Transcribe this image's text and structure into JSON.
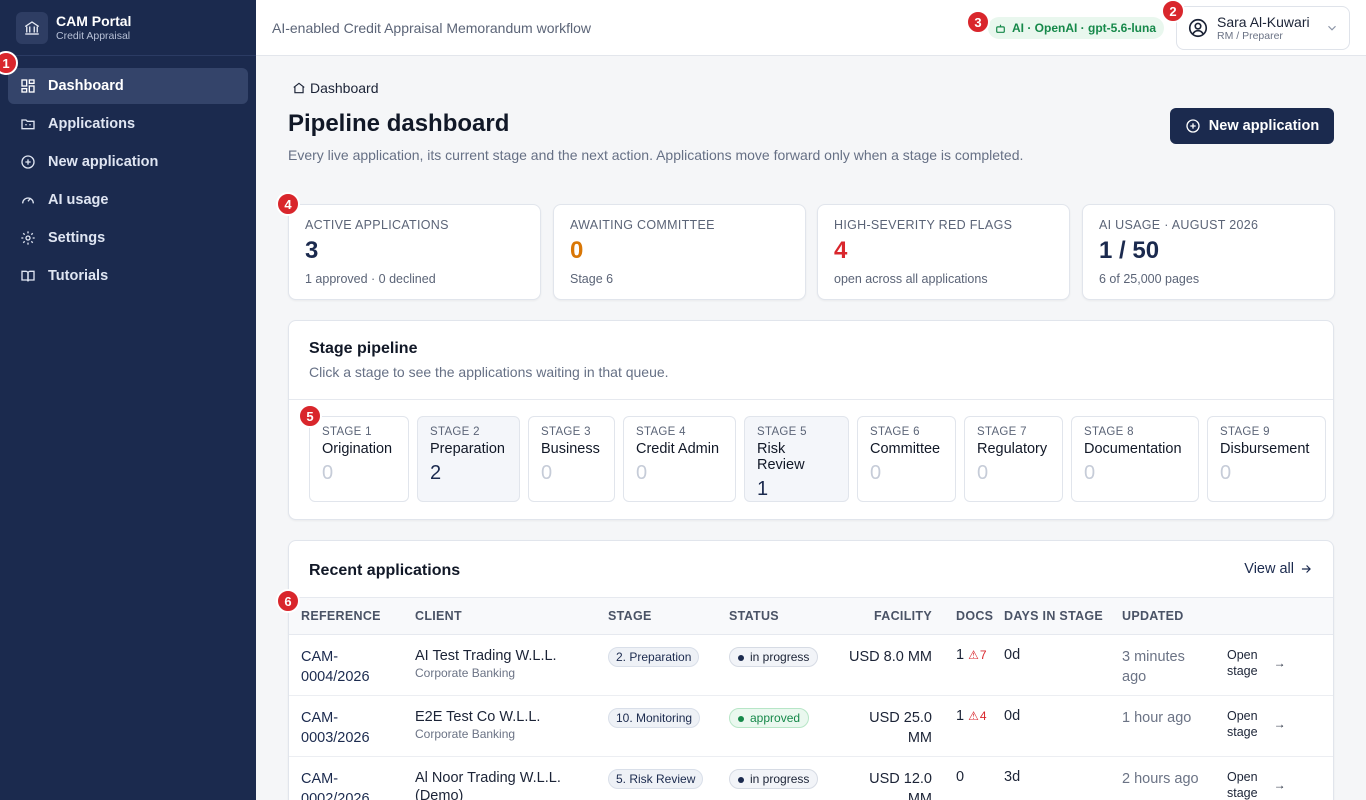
{
  "app": {
    "title": "CAM Portal",
    "subtitle": "Credit Appraisal"
  },
  "sidebar": {
    "items": [
      {
        "label": "Dashboard",
        "icon": "dashboard-icon"
      },
      {
        "label": "Applications",
        "icon": "folder-icon"
      },
      {
        "label": "New application",
        "icon": "plus-circle-icon"
      },
      {
        "label": "AI usage",
        "icon": "gauge-icon"
      },
      {
        "label": "Settings",
        "icon": "gear-icon"
      },
      {
        "label": "Tutorials",
        "icon": "book-icon"
      }
    ]
  },
  "topbar": {
    "caption": "AI-enabled Credit Appraisal Memorandum workflow",
    "ai_chip": "AI · OpenAI · gpt-5.6-luna",
    "user_name": "Sara Al-Kuwari",
    "user_role": "RM / Preparer"
  },
  "badges": [
    "1",
    "2",
    "3",
    "4",
    "5",
    "6"
  ],
  "page": {
    "breadcrumb": "Dashboard",
    "title": "Pipeline dashboard",
    "description": "Every live application, its current stage and the next action. Applications move forward only when a stage is completed.",
    "new_button": "New application"
  },
  "kpis": [
    {
      "label": "ACTIVE APPLICATIONS",
      "value": "3",
      "sub": "1 approved · 0 declined",
      "color": "#1b2a4e"
    },
    {
      "label": "AWAITING COMMITTEE",
      "value": "0",
      "sub": "Stage 6",
      "color": "#d97706"
    },
    {
      "label": "HIGH-SEVERITY RED FLAGS",
      "value": "4",
      "sub": "open across all applications",
      "color": "#d9262c"
    },
    {
      "label": "AI USAGE · AUGUST 2026",
      "value": "1 / 50",
      "sub": "6 of 25,000 pages",
      "color": "#1b2a4e"
    }
  ],
  "pipeline": {
    "title": "Stage pipeline",
    "subtitle": "Click a stage to see the applications waiting in that queue.",
    "stages": [
      {
        "no": "STAGE 1",
        "name": "Origination",
        "count": "0"
      },
      {
        "no": "STAGE 2",
        "name": "Preparation",
        "count": "2"
      },
      {
        "no": "STAGE 3",
        "name": "Business",
        "count": "0"
      },
      {
        "no": "STAGE 4",
        "name": "Credit Admin",
        "count": "0"
      },
      {
        "no": "STAGE 5",
        "name": "Risk Review",
        "count": "1"
      },
      {
        "no": "STAGE 6",
        "name": "Committee",
        "count": "0"
      },
      {
        "no": "STAGE 7",
        "name": "Regulatory",
        "count": "0"
      },
      {
        "no": "STAGE 8",
        "name": "Documentation",
        "count": "0"
      },
      {
        "no": "STAGE 9",
        "name": "Disbursement",
        "count": "0"
      }
    ]
  },
  "recent": {
    "title": "Recent applications",
    "view_all": "View all",
    "columns": [
      "REFERENCE",
      "CLIENT",
      "STAGE",
      "STATUS",
      "FACILITY",
      "DOCS",
      "DAYS IN STAGE",
      "UPDATED"
    ],
    "rows": [
      {
        "ref1": "CAM-",
        "ref2": "0004/2026",
        "client": "AI Test Trading W.L.L.",
        "unit": "Corporate Banking",
        "stage": "2. Preparation",
        "status": "in progress",
        "fac1": "USD 8.0 MM",
        "fac2": "",
        "docs": "1",
        "flags": "7",
        "days": "0d",
        "upd1": "3 minutes",
        "upd2": "ago",
        "open1": "Open",
        "open2": "stage"
      },
      {
        "ref1": "CAM-",
        "ref2": "0003/2026",
        "client": "E2E Test Co W.L.L.",
        "unit": "Corporate Banking",
        "stage": "10. Monitoring",
        "status": "approved",
        "fac1": "USD 25.0",
        "fac2": "MM",
        "docs": "1",
        "flags": "4",
        "days": "0d",
        "upd1": "1 hour ago",
        "upd2": "",
        "open1": "Open",
        "open2": "stage"
      },
      {
        "ref1": "CAM-",
        "ref2": "0002/2026",
        "client": "Al Noor Trading W.L.L.",
        "unit": "(Demo)",
        "stage": "5. Risk Review",
        "status": "in progress",
        "fac1": "USD 12.0",
        "fac2": "MM",
        "docs": "0",
        "flags": "",
        "days": "3d",
        "upd1": "2 hours ago",
        "upd2": "",
        "open1": "Open",
        "open2": "stage"
      }
    ]
  }
}
